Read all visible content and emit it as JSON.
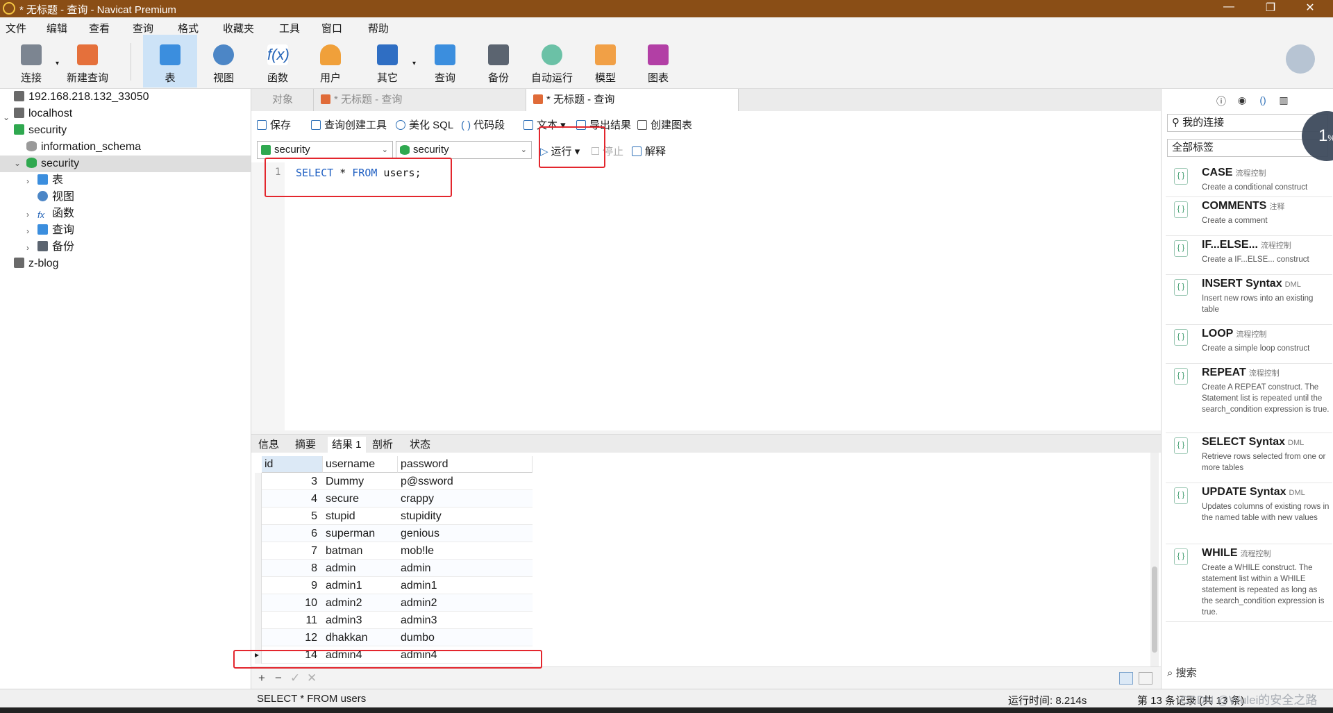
{
  "window": {
    "title": "* 无标题 - 查询 - Navicat Premium",
    "controls": [
      "—",
      "❐",
      "✕"
    ]
  },
  "menu": [
    "文件",
    "编辑",
    "查看",
    "查询",
    "格式",
    "收藏夹",
    "工具",
    "窗口",
    "帮助"
  ],
  "toolbar": {
    "buttons": [
      {
        "label": "连接",
        "icon": "plug-icon"
      },
      {
        "label": "新建查询",
        "icon": "new-query-icon"
      },
      {
        "label": "表",
        "icon": "table-icon"
      },
      {
        "label": "视图",
        "icon": "view-icon"
      },
      {
        "label": "函数",
        "icon": "function-icon"
      },
      {
        "label": "用户",
        "icon": "user-icon"
      },
      {
        "label": "其它",
        "icon": "tools-icon"
      },
      {
        "label": "查询",
        "icon": "query-icon"
      },
      {
        "label": "备份",
        "icon": "backup-icon"
      },
      {
        "label": "自动运行",
        "icon": "robot-icon"
      },
      {
        "label": "模型",
        "icon": "model-icon"
      },
      {
        "label": "图表",
        "icon": "chart-icon"
      }
    ],
    "active": "表"
  },
  "tree": {
    "nodes": [
      {
        "label": "192.168.218.132_33050",
        "level": 0
      },
      {
        "label": "localhost",
        "level": 0
      },
      {
        "label": "security",
        "level": 0
      },
      {
        "label": "information_schema",
        "level": 1
      },
      {
        "label": "security",
        "level": 1,
        "selected": true
      },
      {
        "label": "表",
        "level": 2
      },
      {
        "label": "视图",
        "level": 2
      },
      {
        "label": "函数",
        "level": 2
      },
      {
        "label": "查询",
        "level": 2
      },
      {
        "label": "备份",
        "level": 2
      },
      {
        "label": "z-blog",
        "level": 0
      }
    ]
  },
  "tabs": {
    "items": [
      "对象",
      "* 无标题 - 查询",
      "* 无标题 - 查询"
    ],
    "active_index": 2
  },
  "query_toolbar": {
    "save": "保存",
    "builder": "查询创建工具",
    "beautify": "美化 SQL",
    "snippet": "代码段",
    "text": "文本",
    "export": "导出结果",
    "create_chart": "创建图表",
    "connection": "security",
    "database": "security",
    "run": "运行",
    "stop": "停止",
    "explain": "解释"
  },
  "editor": {
    "line_number": "1",
    "keyword1": "SELECT",
    "rest1": " * ",
    "keyword2": "FROM",
    "rest2": " users;"
  },
  "result_tabs": {
    "items": [
      "信息",
      "摘要",
      "结果 1",
      "剖析",
      "状态"
    ],
    "active_index": 2
  },
  "grid": {
    "columns": [
      "id",
      "username",
      "password"
    ],
    "rows": [
      [
        "3",
        "Dummy",
        "p@ssword"
      ],
      [
        "4",
        "secure",
        "crappy"
      ],
      [
        "5",
        "stupid",
        "stupidity"
      ],
      [
        "6",
        "superman",
        "genious"
      ],
      [
        "7",
        "batman",
        "mob!le"
      ],
      [
        "8",
        "admin",
        "admin"
      ],
      [
        "9",
        "admin1",
        "admin1"
      ],
      [
        "10",
        "admin2",
        "admin2"
      ],
      [
        "11",
        "admin3",
        "admin3"
      ],
      [
        "12",
        "dhakkan",
        "dumbo"
      ],
      [
        "14",
        "admin4",
        "admin4"
      ]
    ],
    "current_row_index": 10,
    "footer_buttons": [
      "+",
      "−",
      "✓",
      "✕"
    ]
  },
  "status": {
    "sql": "SELECT * FROM users",
    "runtime": "运行时间: 8.214s",
    "records": "第 13 条记录 (共 13 条)"
  },
  "right_panel": {
    "icons": [
      "info-icon",
      "eye-icon",
      "brackets-icon",
      "layout-icon"
    ],
    "connection_combo": "我的连接",
    "tag_combo": "全部标签",
    "snippets": [
      {
        "name": "CASE",
        "tag": "流程控制",
        "desc": "Create a conditional construct"
      },
      {
        "name": "COMMENTS",
        "tag": "注释",
        "desc": "Create a comment"
      },
      {
        "name": "IF...ELSE...",
        "tag": "流程控制",
        "desc": "Create a IF...ELSE... construct"
      },
      {
        "name": "INSERT Syntax",
        "tag": "DML",
        "desc": "Insert new rows into an existing table"
      },
      {
        "name": "LOOP",
        "tag": "流程控制",
        "desc": "Create a simple loop construct"
      },
      {
        "name": "REPEAT",
        "tag": "流程控制",
        "desc": "Create A REPEAT construct. The Statement list is repeated until the search_condition expression is true."
      },
      {
        "name": "SELECT Syntax",
        "tag": "DML",
        "desc": "Retrieve rows selected from one or more tables"
      },
      {
        "name": "UPDATE Syntax",
        "tag": "DML",
        "desc": "Updates columns of existing rows in the named table with new values"
      },
      {
        "name": "WHILE",
        "tag": "流程控制",
        "desc": "Create a WHILE construct. The statement list within a WHILE statement is repeated as long as the search_condition expression is true."
      }
    ],
    "search": "搜索"
  },
  "overlay": {
    "bubble": "1",
    "bubble_unit": "%",
    "watermark": "CSDN @Wulei的安全之路"
  }
}
